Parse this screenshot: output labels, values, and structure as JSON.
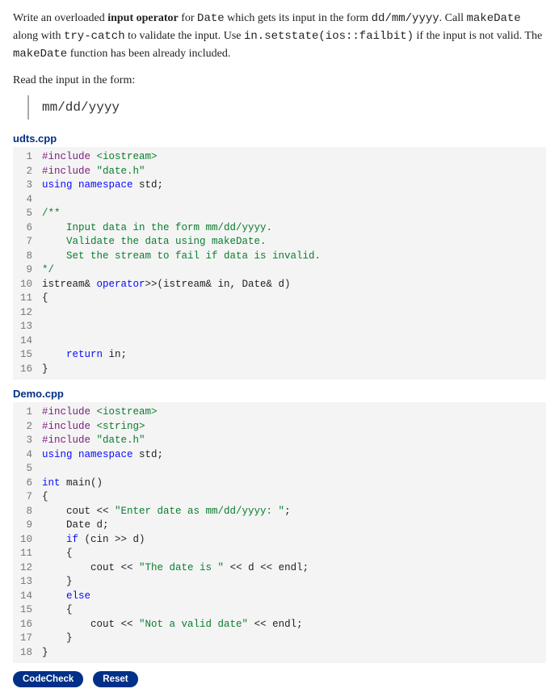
{
  "prompt": {
    "p1_a": "Write an overloaded ",
    "p1_b": "input operator",
    "p1_c": " for ",
    "p1_d": "Date",
    "p1_e": " which gets its input in the form ",
    "p1_f": "dd/mm/yyyy",
    "p1_g": ". Call ",
    "p1_h": "makeDate",
    "p1_i": " along with ",
    "p1_j": "try-catch",
    "p1_k": " to validate the input. Use ",
    "p1_l": "in.setstate(ios::failbit)",
    "p1_m": " if the input is not valid. The ",
    "p1_n": "makeDate",
    "p1_o": " function has been already included.",
    "p2": "Read the input in the form:",
    "hint": "mm/dd/yyyy"
  },
  "files": {
    "udts_name": "udts.cpp",
    "demo_name": "Demo.cpp"
  },
  "udts_lines": [
    {
      "n": "1",
      "segs": [
        {
          "c": "k-pp",
          "t": "#include "
        },
        {
          "c": "k-inc",
          "t": "<iostream>"
        }
      ]
    },
    {
      "n": "2",
      "segs": [
        {
          "c": "k-pp",
          "t": "#include "
        },
        {
          "c": "k-inc",
          "t": "\"date.h\""
        }
      ]
    },
    {
      "n": "3",
      "segs": [
        {
          "c": "k-kw",
          "t": "using"
        },
        {
          "c": "",
          "t": " "
        },
        {
          "c": "k-kw",
          "t": "namespace"
        },
        {
          "c": "",
          "t": " std;"
        }
      ]
    },
    {
      "n": "4",
      "segs": [
        {
          "c": "",
          "t": ""
        }
      ]
    },
    {
      "n": "5",
      "segs": [
        {
          "c": "k-cm",
          "t": "/**"
        }
      ]
    },
    {
      "n": "6",
      "segs": [
        {
          "c": "k-cm",
          "t": "    Input data in the form mm/dd/yyyy."
        }
      ]
    },
    {
      "n": "7",
      "segs": [
        {
          "c": "k-cm",
          "t": "    Validate the data using makeDate."
        }
      ]
    },
    {
      "n": "8",
      "segs": [
        {
          "c": "k-cm",
          "t": "    Set the stream to fail if data is invalid."
        }
      ]
    },
    {
      "n": "9",
      "segs": [
        {
          "c": "k-cm",
          "t": "*/"
        }
      ]
    },
    {
      "n": "10",
      "segs": [
        {
          "c": "",
          "t": "istream& "
        },
        {
          "c": "k-kw",
          "t": "operator"
        },
        {
          "c": "",
          "t": ">>(istream& in, Date& d)"
        }
      ]
    },
    {
      "n": "11",
      "segs": [
        {
          "c": "",
          "t": "{"
        }
      ]
    },
    {
      "n": "12",
      "segs": [
        {
          "c": "",
          "t": ""
        }
      ]
    },
    {
      "n": "13",
      "segs": [
        {
          "c": "",
          "t": ""
        }
      ]
    },
    {
      "n": "14",
      "segs": [
        {
          "c": "",
          "t": ""
        }
      ]
    },
    {
      "n": "15",
      "segs": [
        {
          "c": "",
          "t": "    "
        },
        {
          "c": "k-kw",
          "t": "return"
        },
        {
          "c": "",
          "t": " in;"
        }
      ]
    },
    {
      "n": "16",
      "segs": [
        {
          "c": "",
          "t": "}"
        }
      ]
    }
  ],
  "demo_lines": [
    {
      "n": "1",
      "segs": [
        {
          "c": "k-pp",
          "t": "#include "
        },
        {
          "c": "k-inc",
          "t": "<iostream>"
        }
      ]
    },
    {
      "n": "2",
      "segs": [
        {
          "c": "k-pp",
          "t": "#include "
        },
        {
          "c": "k-inc",
          "t": "<string>"
        }
      ]
    },
    {
      "n": "3",
      "segs": [
        {
          "c": "k-pp",
          "t": "#include "
        },
        {
          "c": "k-inc",
          "t": "\"date.h\""
        }
      ]
    },
    {
      "n": "4",
      "segs": [
        {
          "c": "k-kw",
          "t": "using"
        },
        {
          "c": "",
          "t": " "
        },
        {
          "c": "k-kw",
          "t": "namespace"
        },
        {
          "c": "",
          "t": " std;"
        }
      ]
    },
    {
      "n": "5",
      "segs": [
        {
          "c": "",
          "t": ""
        }
      ]
    },
    {
      "n": "6",
      "segs": [
        {
          "c": "k-type",
          "t": "int"
        },
        {
          "c": "",
          "t": " main()"
        }
      ]
    },
    {
      "n": "7",
      "segs": [
        {
          "c": "",
          "t": "{"
        }
      ]
    },
    {
      "n": "8",
      "segs": [
        {
          "c": "",
          "t": "    cout << "
        },
        {
          "c": "k-str",
          "t": "\"Enter date as mm/dd/yyyy: \""
        },
        {
          "c": "",
          "t": ";"
        }
      ]
    },
    {
      "n": "9",
      "segs": [
        {
          "c": "",
          "t": "    Date d;"
        }
      ]
    },
    {
      "n": "10",
      "segs": [
        {
          "c": "",
          "t": "    "
        },
        {
          "c": "k-kw",
          "t": "if"
        },
        {
          "c": "",
          "t": " (cin >> d)"
        }
      ]
    },
    {
      "n": "11",
      "segs": [
        {
          "c": "",
          "t": "    {"
        }
      ]
    },
    {
      "n": "12",
      "segs": [
        {
          "c": "",
          "t": "        cout << "
        },
        {
          "c": "k-str",
          "t": "\"The date is \""
        },
        {
          "c": "",
          "t": " << d << endl;"
        }
      ]
    },
    {
      "n": "13",
      "segs": [
        {
          "c": "",
          "t": "    }"
        }
      ]
    },
    {
      "n": "14",
      "segs": [
        {
          "c": "",
          "t": "    "
        },
        {
          "c": "k-kw",
          "t": "else"
        }
      ]
    },
    {
      "n": "15",
      "segs": [
        {
          "c": "",
          "t": "    {"
        }
      ]
    },
    {
      "n": "16",
      "segs": [
        {
          "c": "",
          "t": "        cout << "
        },
        {
          "c": "k-str",
          "t": "\"Not a valid date\""
        },
        {
          "c": "",
          "t": " << endl;"
        }
      ]
    },
    {
      "n": "17",
      "segs": [
        {
          "c": "",
          "t": "    }"
        }
      ]
    },
    {
      "n": "18",
      "segs": [
        {
          "c": "",
          "t": "}"
        }
      ]
    }
  ],
  "buttons": {
    "codecheck": "CodeCheck",
    "reset": "Reset"
  }
}
